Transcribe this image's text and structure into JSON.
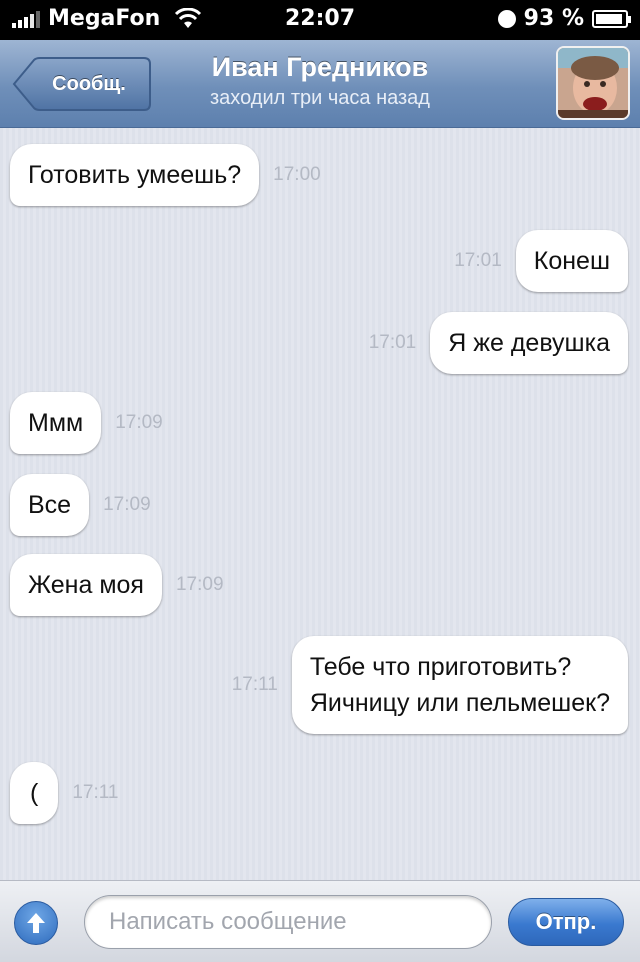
{
  "status_bar": {
    "carrier": "MegaFon",
    "time": "22:07",
    "battery": "93 %",
    "battery_level": 0.93
  },
  "nav": {
    "back_label": "Сообщ.",
    "contact_name": "Иван Гредников",
    "last_seen": "заходил три часа назад"
  },
  "messages": [
    {
      "dir": "in",
      "text": "Готовить умеешь?",
      "time": "17:00"
    },
    {
      "dir": "out",
      "text": "Конеш",
      "time": "17:01"
    },
    {
      "dir": "out",
      "text": "Я же девушка",
      "time": "17:01"
    },
    {
      "dir": "in",
      "text": "Ммм",
      "time": "17:09"
    },
    {
      "dir": "in",
      "text": "Все",
      "time": "17:09"
    },
    {
      "dir": "in",
      "text": "Жена моя",
      "time": "17:09"
    },
    {
      "dir": "out",
      "text": "Тебе что приготовить?\nЯичницу или пельмешек?",
      "time": "17:11"
    },
    {
      "dir": "in",
      "text": "(",
      "time": "17:11"
    }
  ],
  "input": {
    "placeholder": "Написать сообщение",
    "send_label": "Отпр."
  },
  "colors": {
    "nav_bar": "#6f8fb9",
    "send_button": "#3a79cf",
    "bubble": "#ffffff"
  }
}
